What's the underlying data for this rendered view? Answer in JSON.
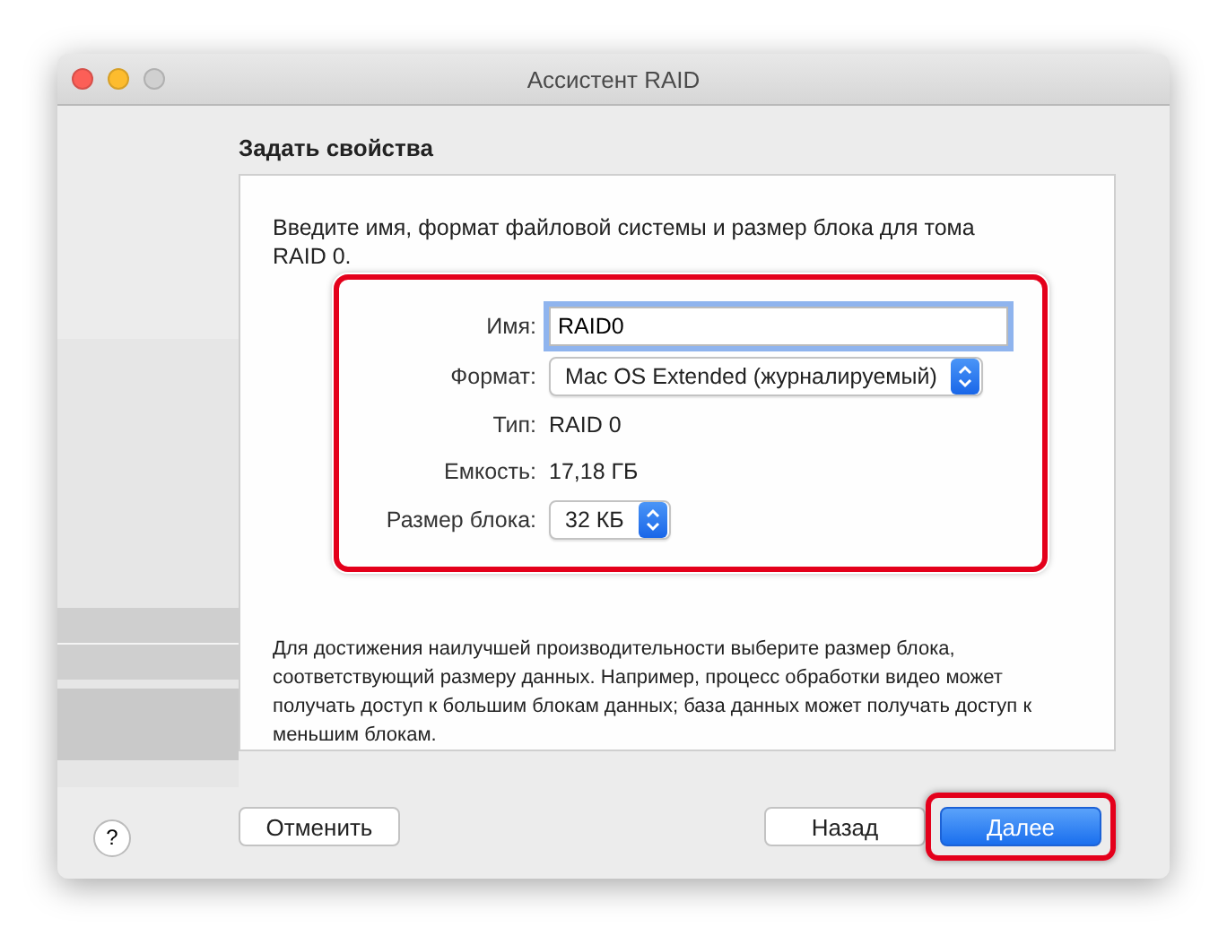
{
  "window": {
    "title": "Ассистент RAID"
  },
  "step_title": "Задать свойства",
  "intro": "Введите имя, формат файловой системы и размер блока для тома RAID 0.",
  "form": {
    "highlighted": true,
    "fields": [
      {
        "kind": "input",
        "label": "Имя:",
        "value": "RAID0",
        "focused": true
      },
      {
        "kind": "popup",
        "label": "Формат:",
        "value": "Mac OS Extended (журналируемый)"
      },
      {
        "kind": "text",
        "label": "Тип:",
        "value": "RAID 0"
      },
      {
        "kind": "text",
        "label": "Емкость:",
        "value": "17,18 ГБ"
      },
      {
        "kind": "popup",
        "label": "Размер блока:",
        "value": "32 КБ"
      }
    ]
  },
  "note": "Для достижения наилучшей производительности выберите размер блока, соответствующий размеру данных. Например, процесс обработки видео может получать доступ к большим блокам данных; база данных может получать доступ к меньшим блокам.",
  "help": "?",
  "buttons": [
    {
      "label": "Отменить",
      "kind": "plain",
      "highlighted": false
    },
    {
      "label": "Назад",
      "kind": "plain",
      "highlighted": false
    },
    {
      "label": "Далее",
      "kind": "default",
      "highlighted": true
    }
  ]
}
